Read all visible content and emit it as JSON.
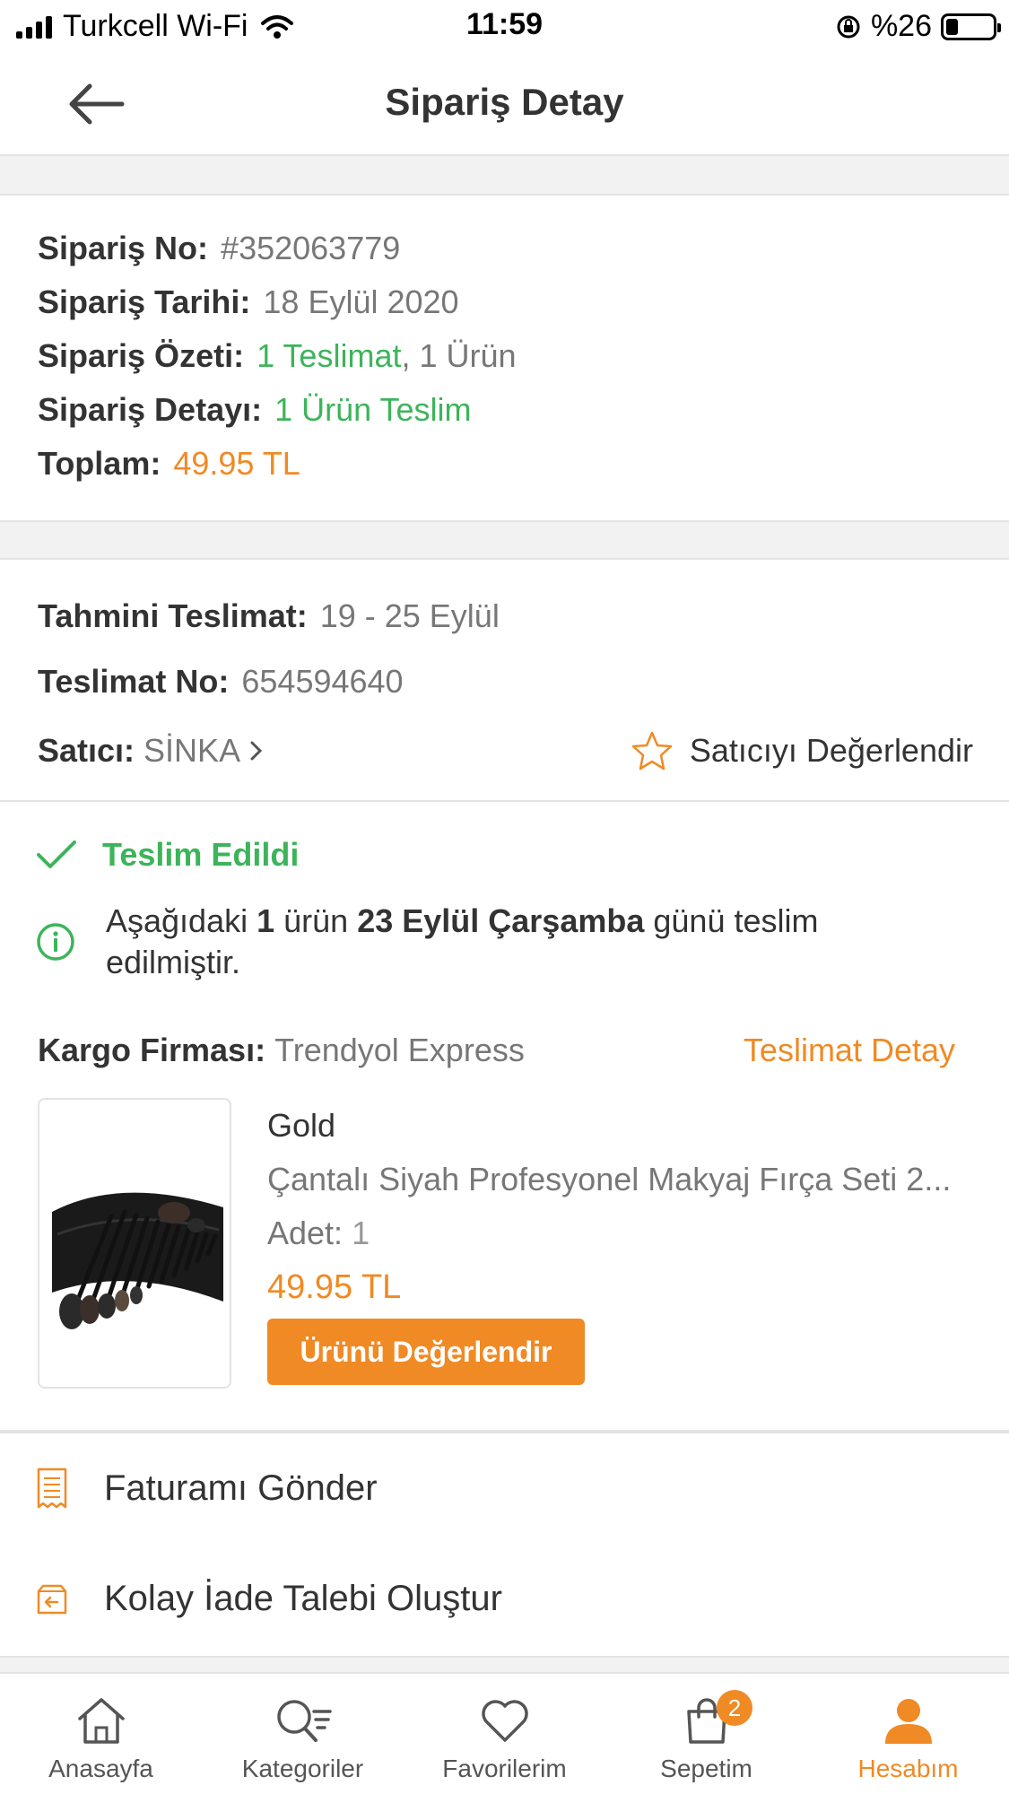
{
  "status_bar": {
    "carrier": "Turkcell Wi-Fi",
    "time": "11:59",
    "battery": "%26",
    "battery_level": 0.26
  },
  "header": {
    "title": "Sipariş Detay"
  },
  "order_summary": {
    "order_no_label": "Sipariş No:",
    "order_no": "#352063779",
    "date_label": "Sipariş Tarihi:",
    "date": "18 Eylül 2020",
    "summary_label": "Sipariş Özeti:",
    "summary_delivery": "1 Teslimat",
    "summary_separator": ",",
    "summary_product": "1 Ürün",
    "detail_label": "Sipariş Detayı:",
    "detail": "1 Ürün Teslim",
    "total_label": "Toplam:",
    "total": "49.95 TL"
  },
  "delivery": {
    "estimated_label": "Tahmini Teslimat:",
    "estimated": "19 - 25 Eylül",
    "delivery_no_label": "Teslimat No:",
    "delivery_no": "654594640",
    "seller_label": "Satıcı:",
    "seller": "SİNKA",
    "rate_seller": "Satıcıyı Değerlendir"
  },
  "shipment": {
    "status": "Teslim Edildi",
    "notice_part1": "Aşağıdaki ",
    "notice_bold1": "1",
    "notice_part2": " ürün ",
    "notice_bold2": "23 Eylül Çarşamba",
    "notice_part3": " günü teslim edilmiştir.",
    "cargo_label": "Kargo Firması:",
    "cargo": "Trendyol Express",
    "delivery_detail": "Teslimat Detay"
  },
  "product": {
    "brand": "Gold",
    "name": "Çantalı Siyah Profesyonel Makyaj Fırça Seti 2...",
    "qty_label": "Adet:",
    "qty": "1",
    "price": "49.95 TL",
    "rate_button": "Ürünü Değerlendir"
  },
  "actions": {
    "send_invoice": "Faturamı Gönder",
    "easy_return": "Kolay İade Talebi Oluştur"
  },
  "tab_bar": {
    "home": "Anasayfa",
    "categories": "Kategoriler",
    "favorites": "Favorilerim",
    "cart": "Sepetim",
    "cart_badge": "2",
    "account": "Hesabım"
  },
  "colors": {
    "accent": "#f08a24",
    "success": "#3db45a"
  }
}
